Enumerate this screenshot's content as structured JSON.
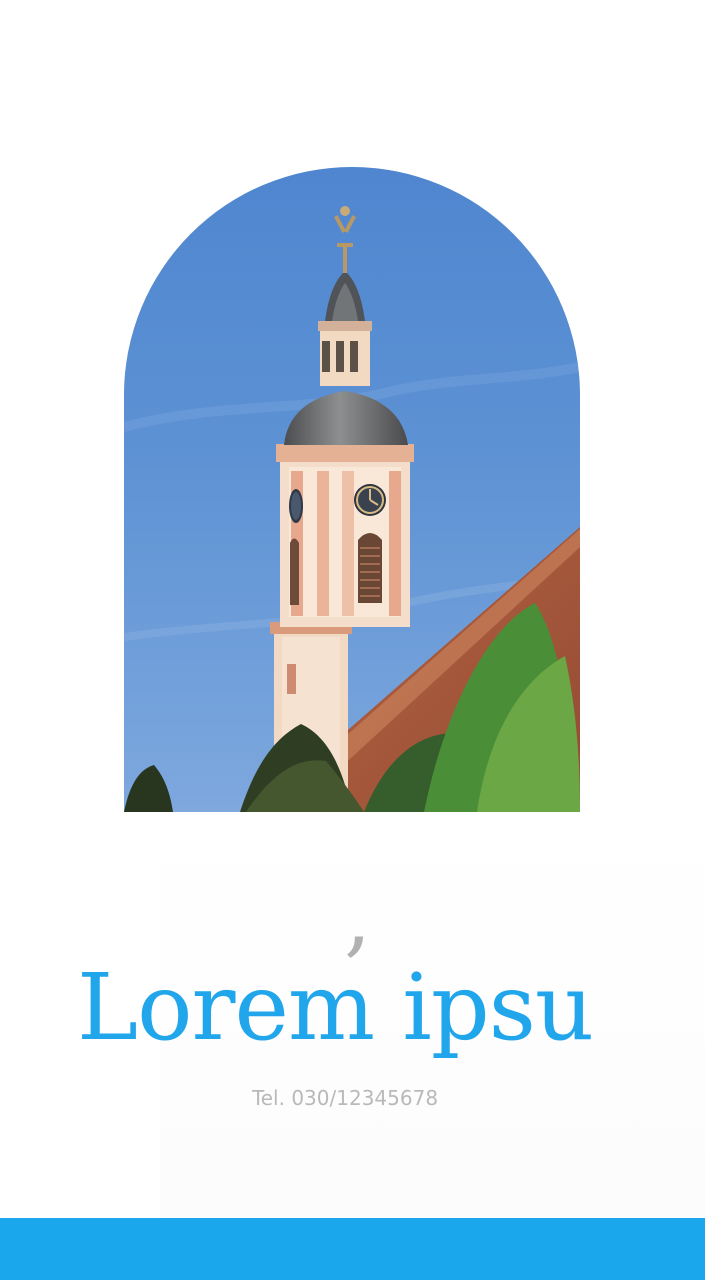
{
  "headline": "Lorem ipsu",
  "quote_mark": "‚",
  "phone": "Tel. 030/12345678",
  "colors": {
    "accent": "#1aa7ec",
    "headline": "#21a6ec",
    "muted_text": "#b9b9b9",
    "quote": "#b1b1b1",
    "background": "#ffffff"
  },
  "image": {
    "subject": "church tower against blue sky",
    "shape": "arch"
  }
}
